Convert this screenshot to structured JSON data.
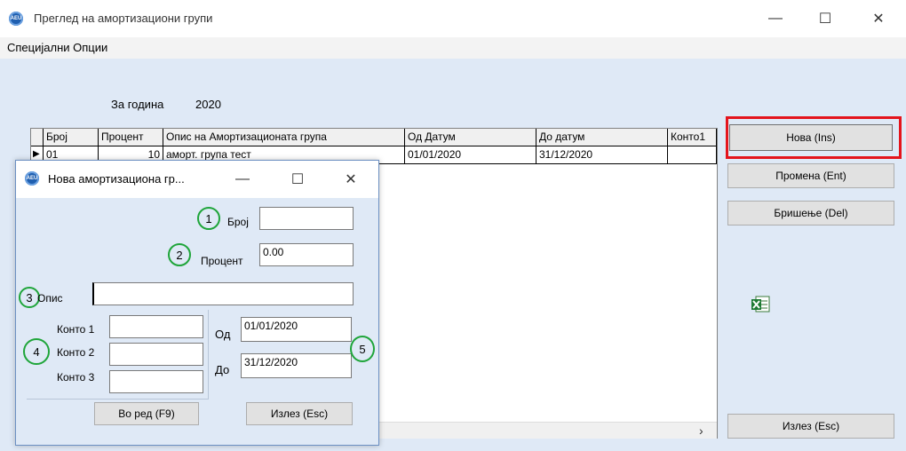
{
  "window": {
    "title": "Преглед на амортизациони групи",
    "app_icon_text": "AEU",
    "minimize": "—",
    "maximize": "☐",
    "close": "✕"
  },
  "menu": {
    "item1": "Специјални Опции"
  },
  "year": {
    "label": "За година",
    "value": "2020"
  },
  "grid": {
    "columns": [
      "Број",
      "Процент",
      "Опис на Амортизационата група",
      "Од Датум",
      "До датум",
      "Конто1"
    ],
    "rows": [
      {
        "broj": "01",
        "procent": "10",
        "opis": "аморт. група тест",
        "od": "01/01/2020",
        "do": "31/12/2020",
        "konto1": ""
      }
    ],
    "scroll_arrow": "›"
  },
  "buttons": {
    "new": "Нова (Ins)",
    "edit": "Промена (Ent)",
    "delete": "Бришење (Del)",
    "exit": "Излез (Esc)"
  },
  "excel_icon": "excel-icon",
  "dialog": {
    "title": "Нова амортизациона гр...",
    "minimize": "—",
    "maximize": "☐",
    "close": "✕",
    "fields": {
      "broj_label": "Број",
      "broj_value": "",
      "procent_label": "Процент",
      "procent_value": "0.00",
      "opis_label": "Опис",
      "opis_value": "",
      "konto1_label": "Конто 1",
      "konto2_label": "Конто 2",
      "konto3_label": "Конто 3",
      "od_label": "Од",
      "od_value": "01/01/2020",
      "do_label": "До",
      "do_value": "31/12/2020"
    },
    "buttons": {
      "save": "Во ред (F9)",
      "exit": "Излез (Esc)"
    },
    "markers": [
      "1",
      "2",
      "3",
      "4",
      "5"
    ]
  },
  "colors": {
    "client_bg": "#dfe9f6",
    "highlight": "#e4141c",
    "marker": "#1fa53a"
  }
}
